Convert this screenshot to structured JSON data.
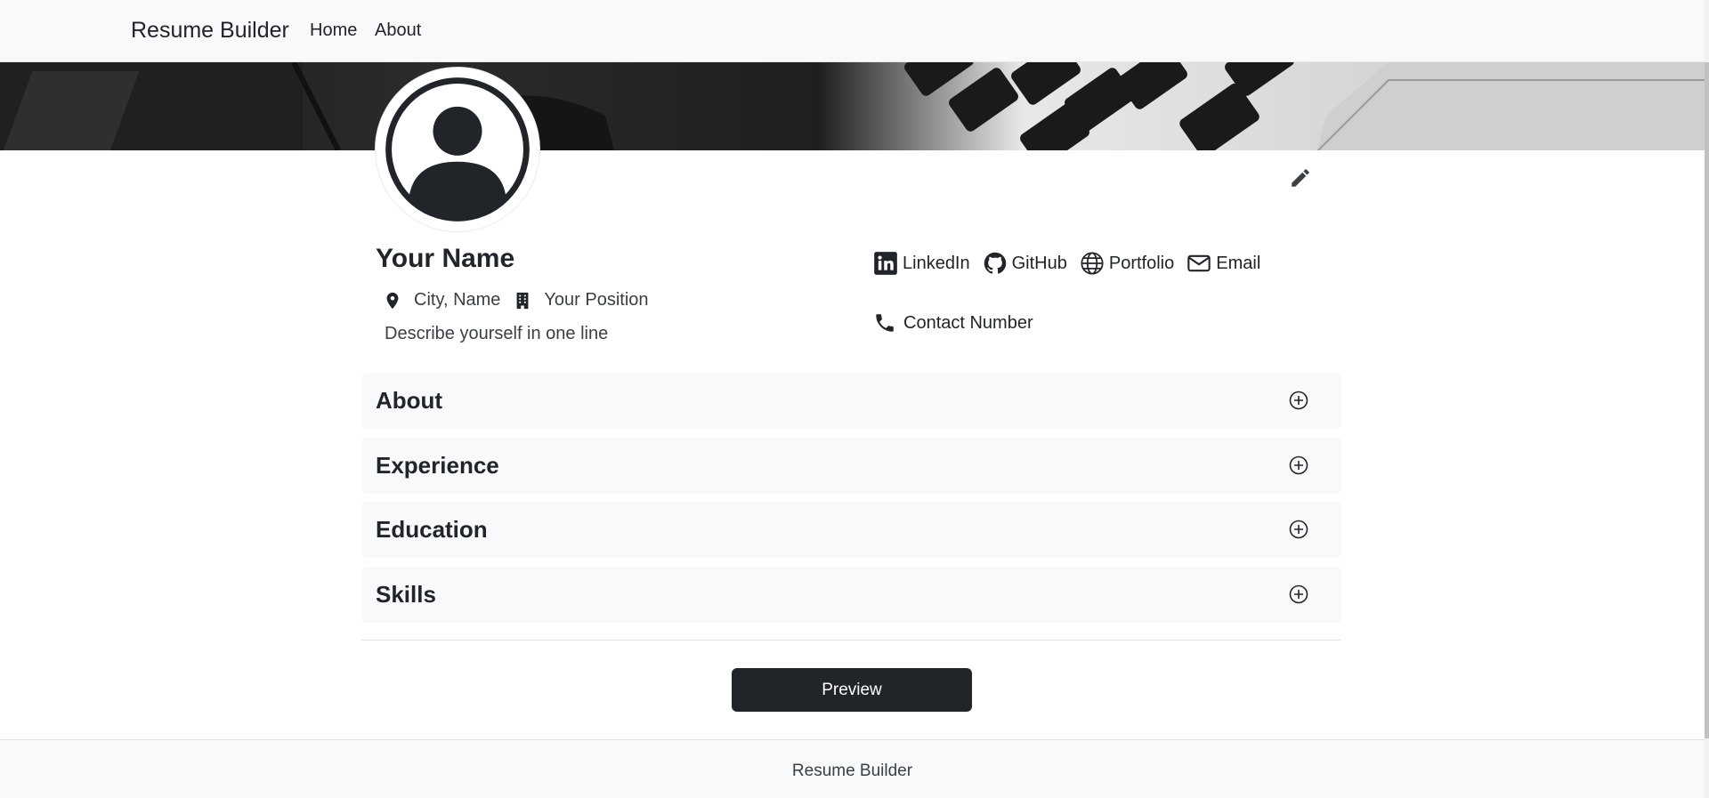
{
  "navbar": {
    "brand": "Resume Builder",
    "links": [
      {
        "label": "Home"
      },
      {
        "label": "About"
      }
    ]
  },
  "profile": {
    "name": "Your Name",
    "location": "City, Name",
    "position": "Your Position",
    "tagline": "Describe yourself in one line",
    "edit_icon": "pencil-icon",
    "avatar_icon": "user-avatar-icon"
  },
  "links": [
    {
      "label": "LinkedIn",
      "icon": "linkedin-icon"
    },
    {
      "label": "GitHub",
      "icon": "github-icon"
    },
    {
      "label": "Portfolio",
      "icon": "globe-icon"
    },
    {
      "label": "Email",
      "icon": "envelope-icon"
    }
  ],
  "contact": {
    "label": "Contact Number",
    "icon": "phone-icon"
  },
  "sections": [
    {
      "title": "About"
    },
    {
      "title": "Experience"
    },
    {
      "title": "Education"
    },
    {
      "title": "Skills"
    }
  ],
  "preview_button": "Preview",
  "footer": {
    "text": "Resume Builder"
  },
  "colors": {
    "primary_dark": "#212529",
    "light_bg": "#f8f9fa",
    "border": "#dee2e6"
  }
}
